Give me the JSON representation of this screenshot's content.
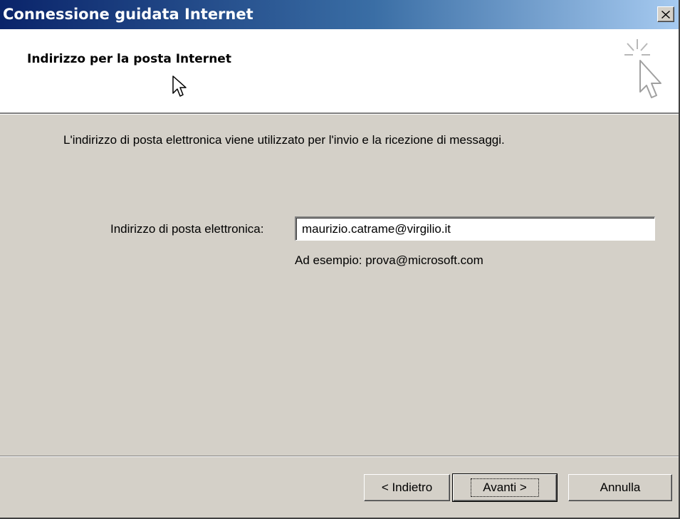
{
  "window": {
    "title": "Connessione guidata Internet",
    "close_label": "×"
  },
  "header": {
    "title": "Indirizzo per la posta Internet"
  },
  "content": {
    "description": "L'indirizzo di posta elettronica viene utilizzato per l'invio e la ricezione di messaggi.",
    "email_label": "Indirizzo di posta elettronica:",
    "email_value": "maurizio.catrame@virgilio.it",
    "example": "Ad esempio: prova@microsoft.com"
  },
  "buttons": {
    "back": "< Indietro",
    "next": "Avanti >",
    "cancel": "Annulla"
  },
  "icons": {
    "close": "close-icon",
    "wizard": "wizard-cursor-icon",
    "mouse": "mouse-pointer-icon"
  },
  "colors": {
    "title_start": "#0a246a",
    "title_end": "#a6caf0",
    "dialog_bg": "#d4d0c8"
  }
}
